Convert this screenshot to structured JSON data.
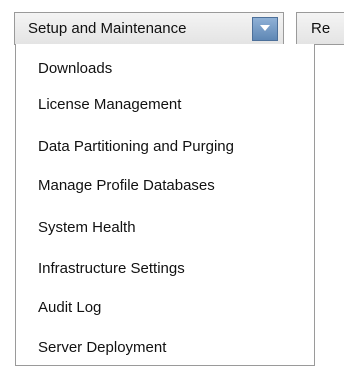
{
  "menubar": {
    "active_menu_label": "Setup and Maintenance",
    "next_tab_label": "Re",
    "arrow_icon": "chevron-down-icon",
    "accent_color": "#6f95c2"
  },
  "dropdown": {
    "items": [
      {
        "label": "Downloads"
      },
      {
        "label": "License Management"
      },
      {
        "label": "Data Partitioning and Purging"
      },
      {
        "label": "Manage Profile Databases"
      },
      {
        "label": "System Health"
      },
      {
        "label": "Infrastructure Settings"
      },
      {
        "label": "Audit Log"
      },
      {
        "label": "Server Deployment"
      }
    ]
  }
}
